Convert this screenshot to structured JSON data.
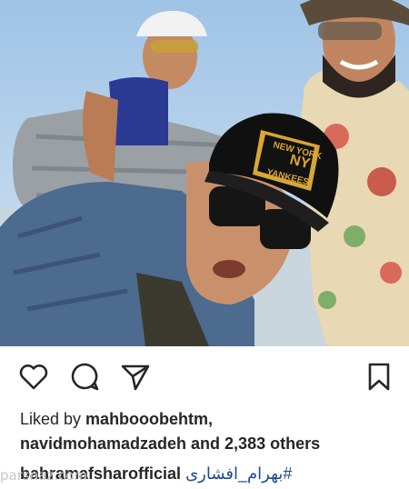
{
  "post": {
    "cap_logo_line1": "NEW YORK",
    "cap_logo_line2": "YANKEES",
    "likes_prefix": "Liked by ",
    "liker_1": "mahbooobehtm",
    "liker_1_suffix": ",",
    "liker_2": "navidmohamadzadeh",
    "likes_suffix": " and 2,383 others",
    "caption_user": "bahramafsharofficial",
    "caption_hashtag": "#بهرام_افشاری"
  },
  "watermark": "parsnaz.com",
  "icons": [
    "heart-icon",
    "comment-icon",
    "share-icon",
    "bookmark-icon"
  ],
  "colors": {
    "text": "#262626",
    "hashtag": "#1f4b8e",
    "watermark": "#c7c7c7"
  }
}
